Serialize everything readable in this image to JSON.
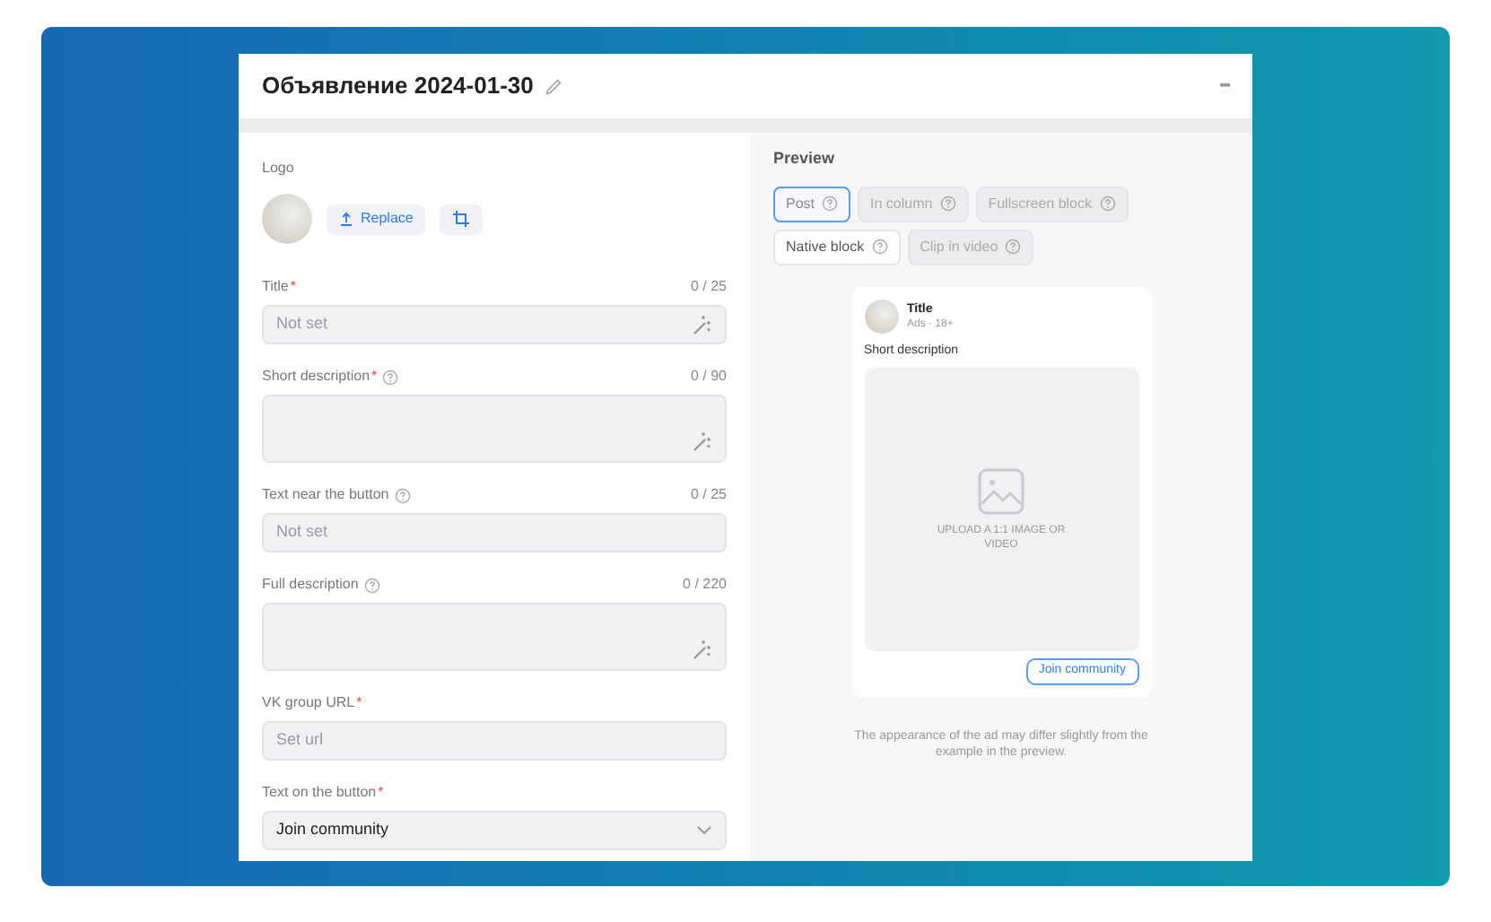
{
  "header": {
    "title": "Объявление 2024-01-30",
    "menu": "•••"
  },
  "logo": {
    "label": "Logo",
    "replace": "Replace"
  },
  "fields": [
    {
      "kind": "input",
      "label": "Title",
      "required": "*",
      "help": false,
      "counter": "0 / 25",
      "placeholder": "Not set",
      "wand": true
    },
    {
      "kind": "textarea",
      "label": "Short description",
      "required": "*",
      "help": true,
      "counter": "0 / 90",
      "wand": true
    },
    {
      "kind": "input",
      "label": "Text near the button",
      "help": true,
      "counter": "0 / 25",
      "placeholder": "Not set",
      "wand": false
    },
    {
      "kind": "textarea",
      "label": "Full description",
      "help": true,
      "counter": "0 / 220",
      "wand": true
    },
    {
      "kind": "input",
      "label": "VK group URL",
      "required": "*",
      "help": false,
      "placeholder": "Set url",
      "wand": false
    },
    {
      "kind": "select",
      "label": "Text on the button",
      "required": "*",
      "help": false,
      "value": "Join community",
      "wand": false
    }
  ],
  "preview": {
    "title": "Preview",
    "tabs": [
      {
        "label": "Post",
        "selected": true,
        "highlighted": false
      },
      {
        "label": "In column",
        "selected": false,
        "highlighted": false
      },
      {
        "label": "Fullscreen block",
        "selected": false,
        "highlighted": false
      },
      {
        "label": "Native block",
        "selected": false,
        "highlighted": true
      },
      {
        "label": "Clip in video",
        "selected": false,
        "highlighted": false
      }
    ],
    "card": {
      "title": "Title",
      "meta": "Ads · 18+",
      "text": "Short description",
      "upload": "UPLOAD A 1:1 IMAGE OR VIDEO",
      "button": "Join community"
    },
    "note": "The appearance of the ad may differ slightly from the example in the preview."
  }
}
